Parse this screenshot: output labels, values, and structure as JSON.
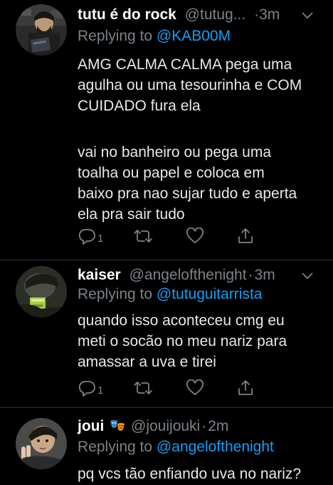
{
  "tweets": [
    {
      "name": "tutu é do rock",
      "handle": "@tutug...",
      "separator": "·",
      "time": "3m",
      "replying_prefix": "Replying to ",
      "replying_to": "@KAB00M",
      "body_para1": [
        "AMG CALMA CALMA pega uma",
        "agulha ou uma tesourinha e COM",
        "CUIDADO fura ela"
      ],
      "body_para2": [
        "vai no banheiro ou pega uma",
        "toalha ou papel e coloca em",
        "baixo pra nao sujar tudo e aperta",
        "ela pra sair tudo"
      ],
      "reply_count": "1"
    },
    {
      "name": "kaiser",
      "handle": "@angelofthenight",
      "separator": "·",
      "time": "3m",
      "replying_prefix": "Replying to ",
      "replying_to": "@tutuguitarrista",
      "body_para1": [
        "quando isso aconteceu cmg eu",
        "meti o socão no meu nariz para",
        "amassar a uva e tirei"
      ],
      "reply_count": "1"
    },
    {
      "name": "joui",
      "handle": "@jouijouki",
      "separator": "·",
      "time": "2m",
      "replying_prefix": "Replying to ",
      "replying_to": "@angelofthenight",
      "body_para1": [
        "pq vcs tão enfiando uva no nariz?"
      ],
      "name_emoji": "performing-arts-masks-icon"
    }
  ],
  "icons": [
    "reply-icon",
    "retweet-icon",
    "like-icon",
    "share-icon",
    "chevron-down-icon"
  ],
  "colors": {
    "background": "#000000",
    "text": "#e7e9ea",
    "muted": "#7b8289",
    "link": "#1d9bf0",
    "divider": "#2f3336"
  }
}
